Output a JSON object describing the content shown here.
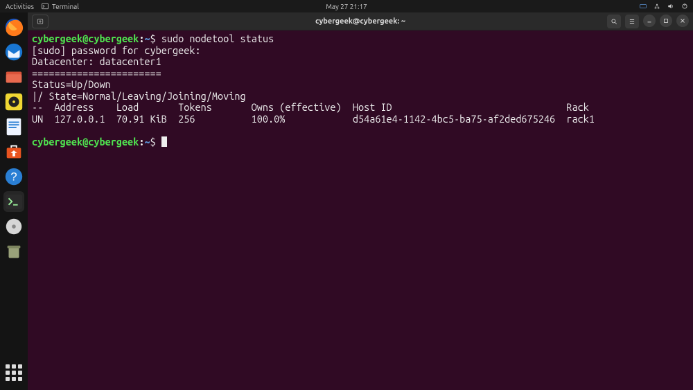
{
  "panel": {
    "activities": "Activities",
    "app_label": "Terminal",
    "clock": "May 27  21:17"
  },
  "window": {
    "title": "cybergeek@cybergeek: ~"
  },
  "prompt": {
    "user": "cybergeek",
    "host": "cybergeek",
    "path": "~",
    "symbol": "$"
  },
  "cmd1": "sudo nodetool status",
  "out": {
    "l1": "[sudo] password for cybergeek:",
    "l2": "Datacenter: datacenter1",
    "l3": "=======================",
    "l4": "Status=Up/Down",
    "l5": "|/ State=Normal/Leaving/Joining/Moving",
    "hdr": "--  Address    Load       Tokens       Owns (effective)  Host ID                               Rack",
    "row": "UN  127.0.0.1  70.91 KiB  256          100.0%            d54a61e4-1142-4bc5-ba75-af2ded675246  rack1"
  }
}
